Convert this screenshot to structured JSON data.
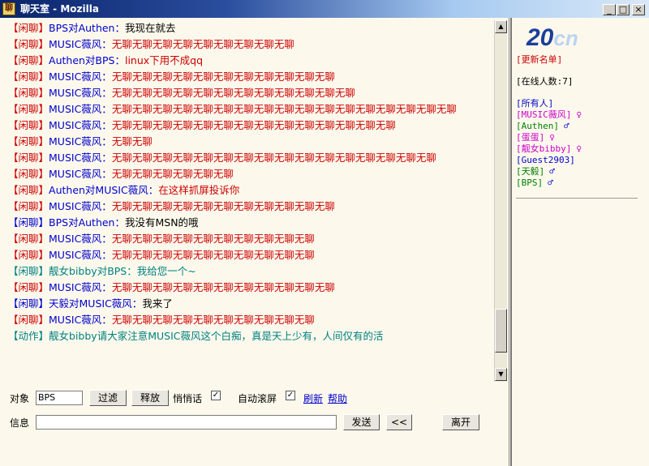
{
  "window": {
    "title": "聊天室 - Mozilla",
    "minimize": "_",
    "maximize": "□",
    "close": "×"
  },
  "chat": {
    "messages": [
      {
        "tag": "【闲聊】",
        "tag_color": "#cc0000",
        "speaker": "BPS对Authen：",
        "speaker_color": "#0000cc",
        "text": "我现在就去",
        "text_color": "#000000"
      },
      {
        "tag": "【闲聊】",
        "tag_color": "#cc0000",
        "speaker": "MUSIC薇风：",
        "speaker_color": "#0000cc",
        "text": "无聊无聊无聊无聊无聊无聊无聊无聊无聊",
        "text_color": "#cc0000"
      },
      {
        "tag": "【闲聊】",
        "tag_color": "#cc0000",
        "speaker": "Authen对BPS：",
        "speaker_color": "#0000cc",
        "text": "linux下用不成qq",
        "text_color": "#cc0000"
      },
      {
        "tag": "【闲聊】",
        "tag_color": "#cc0000",
        "speaker": "MUSIC薇风：",
        "speaker_color": "#0000cc",
        "text": "无聊无聊无聊无聊无聊无聊无聊无聊无聊无聊无聊",
        "text_color": "#cc0000"
      },
      {
        "tag": "【闲聊】",
        "tag_color": "#cc0000",
        "speaker": "MUSIC薇风：",
        "speaker_color": "#0000cc",
        "text": "无聊无聊无聊无聊无聊无聊无聊无聊无聊无聊无聊无聊",
        "text_color": "#cc0000"
      },
      {
        "tag": "【闲聊】",
        "tag_color": "#cc0000",
        "speaker": "MUSIC薇风：",
        "speaker_color": "#0000cc",
        "text": "无聊无聊无聊无聊无聊无聊无聊无聊无聊无聊无聊无聊无聊无聊无聊无聊无聊",
        "text_color": "#cc0000"
      },
      {
        "tag": "【闲聊】",
        "tag_color": "#cc0000",
        "speaker": "MUSIC薇风：",
        "speaker_color": "#0000cc",
        "text": "无聊无聊无聊无聊无聊无聊无聊无聊无聊无聊无聊无聊无聊无聊",
        "text_color": "#cc0000"
      },
      {
        "tag": "【闲聊】",
        "tag_color": "#cc0000",
        "speaker": "MUSIC薇风：",
        "speaker_color": "#0000cc",
        "text": "无聊无聊",
        "text_color": "#cc0000"
      },
      {
        "tag": "【闲聊】",
        "tag_color": "#cc0000",
        "speaker": "MUSIC薇风：",
        "speaker_color": "#0000cc",
        "text": "无聊无聊无聊无聊无聊无聊无聊无聊无聊无聊无聊无聊无聊无聊无聊无聊",
        "text_color": "#cc0000"
      },
      {
        "tag": "【闲聊】",
        "tag_color": "#cc0000",
        "speaker": "MUSIC薇风：",
        "speaker_color": "#0000cc",
        "text": "无聊无聊无聊无聊无聊无聊",
        "text_color": "#cc0000"
      },
      {
        "tag": "【闲聊】",
        "tag_color": "#cc0000",
        "speaker": "Authen对MUSIC薇风：",
        "speaker_color": "#0000cc",
        "text": "在这样抓屏投诉你",
        "text_color": "#cc0000"
      },
      {
        "tag": "【闲聊】",
        "tag_color": "#cc0000",
        "speaker": "MUSIC薇风：",
        "speaker_color": "#0000cc",
        "text": "无聊无聊无聊无聊无聊无聊无聊无聊无聊无聊无聊",
        "text_color": "#cc0000"
      },
      {
        "tag": "【闲聊】",
        "tag_color": "#0000cc",
        "speaker": "BPS对Authen：",
        "speaker_color": "#0000cc",
        "text": "我没有MSN的哦",
        "text_color": "#000000"
      },
      {
        "tag": "【闲聊】",
        "tag_color": "#cc0000",
        "speaker": "MUSIC薇风：",
        "speaker_color": "#0000cc",
        "text": "无聊无聊无聊无聊无聊无聊无聊无聊无聊无聊",
        "text_color": "#cc0000"
      },
      {
        "tag": "【闲聊】",
        "tag_color": "#cc0000",
        "speaker": "MUSIC薇风：",
        "speaker_color": "#0000cc",
        "text": "无聊无聊无聊无聊无聊无聊无聊无聊无聊无聊",
        "text_color": "#cc0000"
      },
      {
        "tag": "【闲聊】",
        "tag_color": "#008080",
        "speaker": "靓女bibby对BPS：",
        "speaker_color": "#008080",
        "text": "我给您一个~",
        "text_color": "#008080"
      },
      {
        "tag": "【闲聊】",
        "tag_color": "#cc0000",
        "speaker": "MUSIC薇风：",
        "speaker_color": "#0000cc",
        "text": "无聊无聊无聊无聊无聊无聊无聊无聊无聊无聊无聊",
        "text_color": "#cc0000"
      },
      {
        "tag": "【闲聊】",
        "tag_color": "#0000cc",
        "speaker": "天毅对MUSIC薇风：",
        "speaker_color": "#0000cc",
        "text": "我来了",
        "text_color": "#000000"
      },
      {
        "tag": "【闲聊】",
        "tag_color": "#cc0000",
        "speaker": "MUSIC薇风：",
        "speaker_color": "#0000cc",
        "text": "无聊无聊无聊无聊无聊无聊无聊无聊无聊无聊",
        "text_color": "#cc0000"
      },
      {
        "tag": "【动作】",
        "tag_color": "#008080",
        "speaker": "靓女bibby",
        "speaker_color": "#008080",
        "text": "请大家注意MUSIC薇风这个白痴，真是天上少有，人间仅有的活",
        "text_color": "#008080"
      }
    ]
  },
  "controls": {
    "target_label": "对象",
    "target_value": "BPS",
    "filter_button": "过滤",
    "release_button": "释放",
    "whisper_label": "悄悄话",
    "whisper_checked": "✓",
    "autoscroll_label": "自动滚屏",
    "autoscroll_checked": "✓",
    "refresh_link": "刷新",
    "help_link": "帮助",
    "message_label": "信息",
    "message_value": "",
    "send_button": "发送",
    "back_button": "<<",
    "leave_button": "离开"
  },
  "sidebar": {
    "logo_number": "20",
    "logo_suffix": "cn",
    "refresh_list": "[更新名单]",
    "online_count": "[在线人数:7]",
    "users": [
      {
        "name": "[所有人]",
        "color": "#0000cc",
        "gender": ""
      },
      {
        "name": "[MUSIC薇风]",
        "color": "#cc00cc",
        "gender": "♀"
      },
      {
        "name": "[Authen]",
        "color": "#008000",
        "gender": "♂"
      },
      {
        "name": "[蛋蛋]",
        "color": "#cc00cc",
        "gender": "♀"
      },
      {
        "name": "[靓女bibby]",
        "color": "#cc00cc",
        "gender": "♀"
      },
      {
        "name": "[Guest2903]",
        "color": "#0000cc",
        "gender": ""
      },
      {
        "name": "[天毅]",
        "color": "#008000",
        "gender": "♂"
      },
      {
        "name": "[BPS]",
        "color": "#008000",
        "gender": "♂"
      }
    ]
  }
}
